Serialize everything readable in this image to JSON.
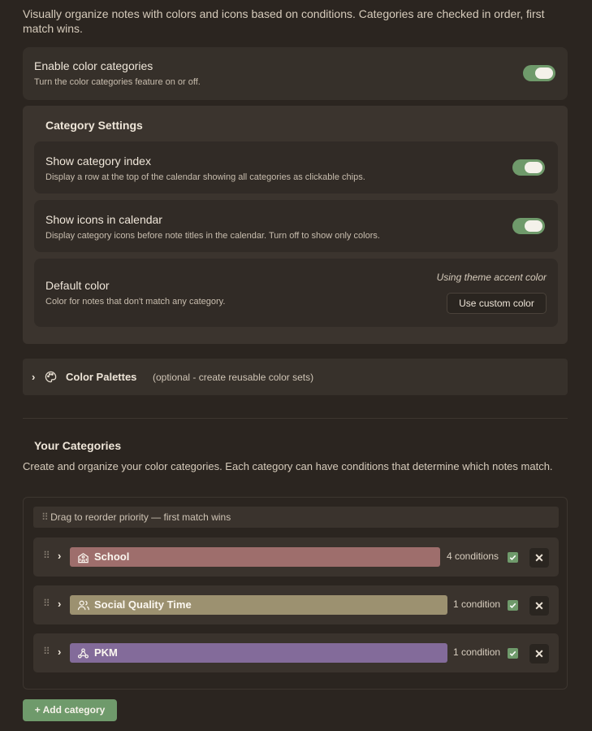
{
  "intro": "Visually organize notes with colors and icons based on conditions. Categories are checked in order, first match wins.",
  "enable": {
    "title": "Enable color categories",
    "desc": "Turn the color categories feature on or off.",
    "on": true
  },
  "category_settings": {
    "title": "Category Settings",
    "show_index": {
      "title": "Show category index",
      "desc": "Display a row at the top of the calendar showing all categories as clickable chips.",
      "on": true
    },
    "show_icons": {
      "title": "Show icons in calendar",
      "desc": "Display category icons before note titles in the calendar. Turn off to show only colors.",
      "on": true
    },
    "default_color": {
      "title": "Default color",
      "desc": "Color for notes that don't match any category.",
      "status": "Using theme accent color",
      "button": "Use custom color"
    }
  },
  "palettes": {
    "title": "Color Palettes",
    "note": "(optional - create reusable color sets)",
    "icon": "palette-icon"
  },
  "your_categories": {
    "title": "Your Categories",
    "desc": "Create and organize your color categories. Each category can have conditions that determine which notes match.",
    "drag_hint": "Drag to reorder priority — first match wins",
    "items": [
      {
        "name": "School",
        "conditions": "4 conditions",
        "color": "#9e6e6c",
        "icon": "school-icon",
        "enabled": true
      },
      {
        "name": "Social Quality Time",
        "conditions": "1 condition",
        "color": "#9c9170",
        "icon": "users-icon",
        "enabled": true
      },
      {
        "name": "PKM",
        "conditions": "1 condition",
        "color": "#836b9a",
        "icon": "network-icon",
        "enabled": true
      }
    ],
    "add_button": "+ Add category"
  }
}
